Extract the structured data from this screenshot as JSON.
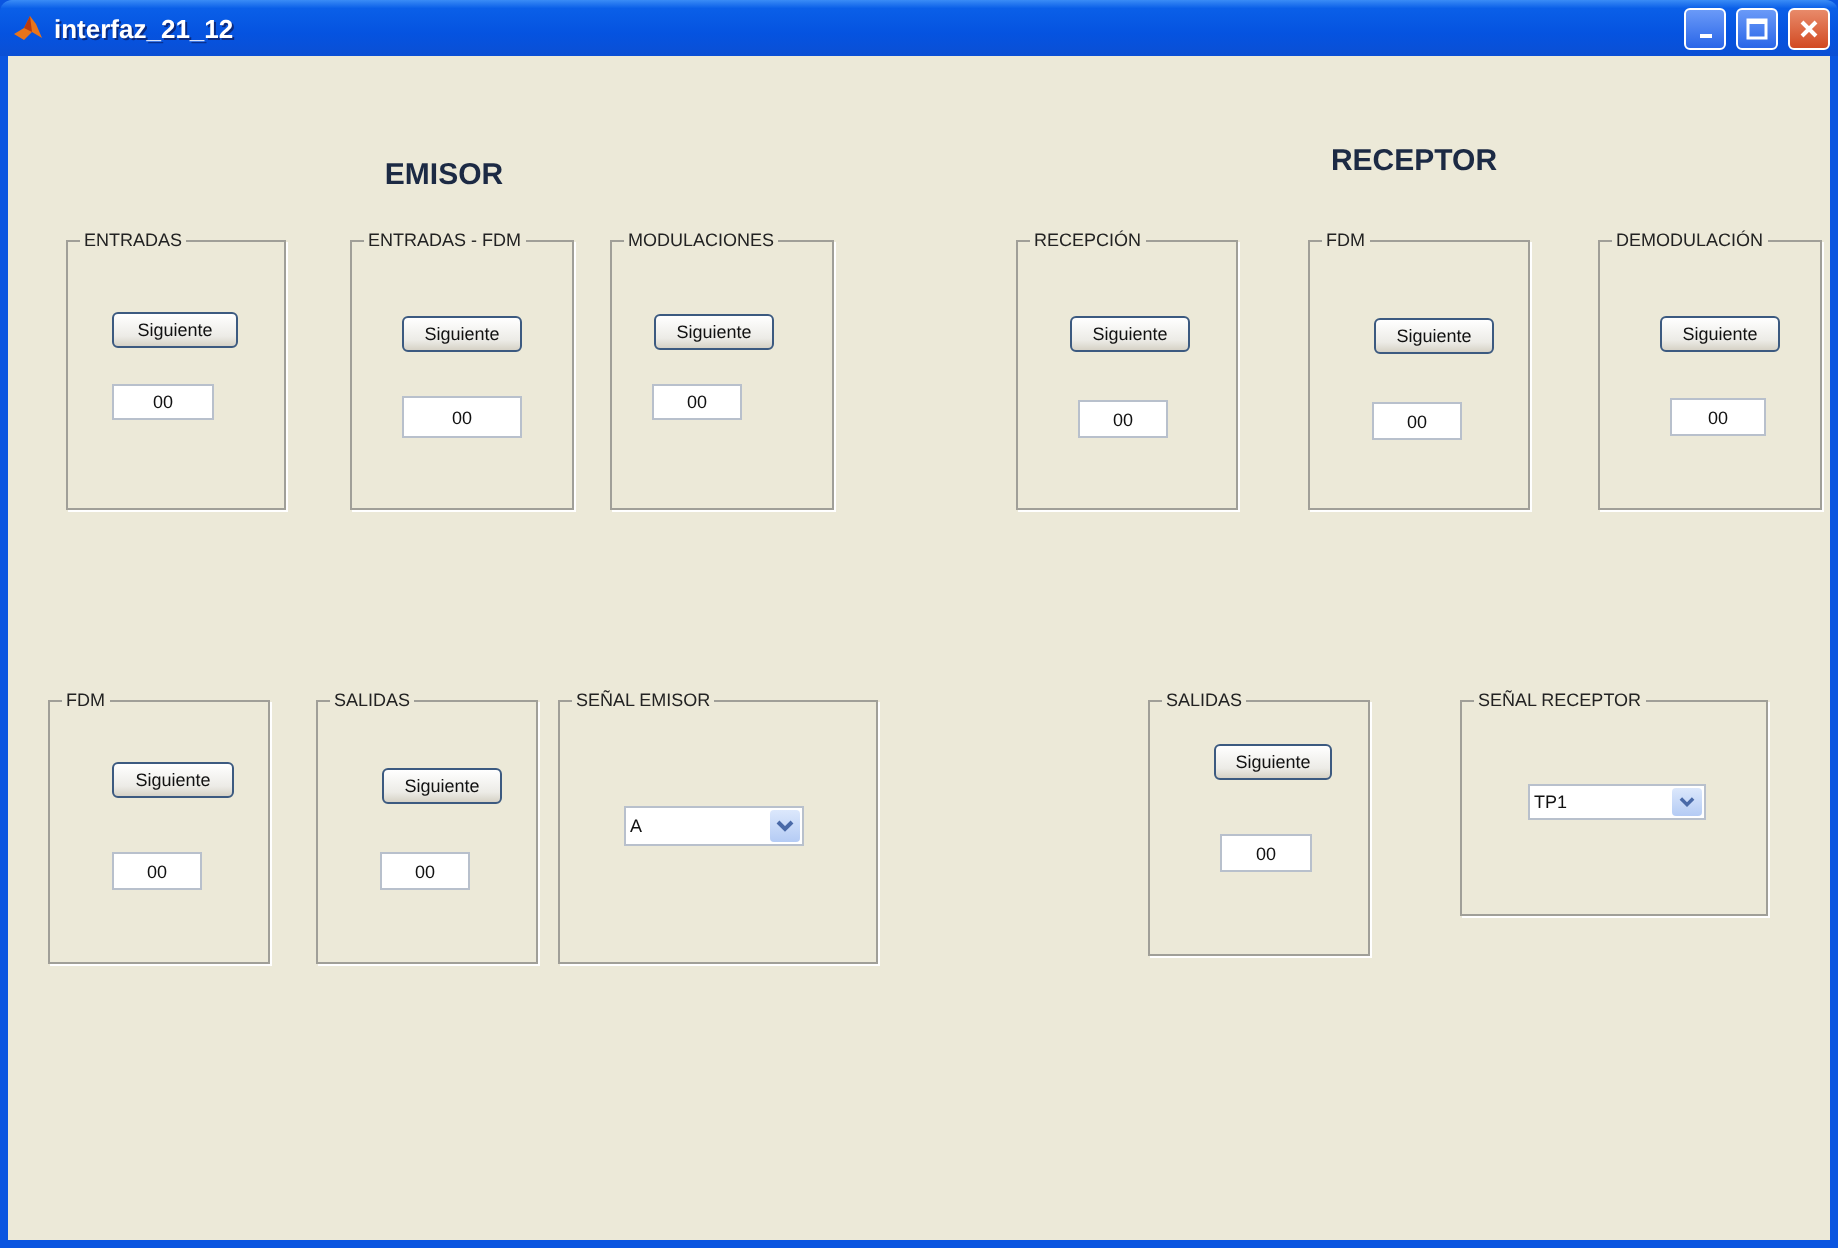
{
  "window": {
    "title": "interfaz_21_12"
  },
  "sections": [
    {
      "title": "EMISOR"
    },
    {
      "title": "RECEPTOR"
    }
  ],
  "top_row": [
    {
      "title": "ENTRADAS",
      "kind": "counter",
      "button": "Siguiente",
      "value": "00"
    },
    {
      "title": "ENTRADAS - FDM",
      "kind": "counter",
      "button": "Siguiente",
      "value": "00"
    },
    {
      "title": "MODULACIONES",
      "kind": "counter",
      "button": "Siguiente",
      "value": "00"
    },
    {
      "title": "RECEPCIÓN",
      "kind": "counter",
      "button": "Siguiente",
      "value": "00"
    },
    {
      "title": "FDM",
      "kind": "counter",
      "button": "Siguiente",
      "value": "00"
    },
    {
      "title": "DEMODULACIÓN",
      "kind": "counter",
      "button": "Siguiente",
      "value": "00"
    }
  ],
  "bottom_row": [
    {
      "title": "FDM",
      "kind": "counter",
      "button": "Siguiente",
      "value": "00"
    },
    {
      "title": "SALIDAS",
      "kind": "counter",
      "button": "Siguiente",
      "value": "00"
    },
    {
      "title": "SEÑAL EMISOR",
      "kind": "select",
      "value": "A"
    },
    {
      "title": "SALIDAS",
      "kind": "counter",
      "button": "Siguiente",
      "value": "00"
    },
    {
      "title": "SEÑAL RECEPTOR",
      "kind": "select",
      "value": "TP1"
    }
  ]
}
